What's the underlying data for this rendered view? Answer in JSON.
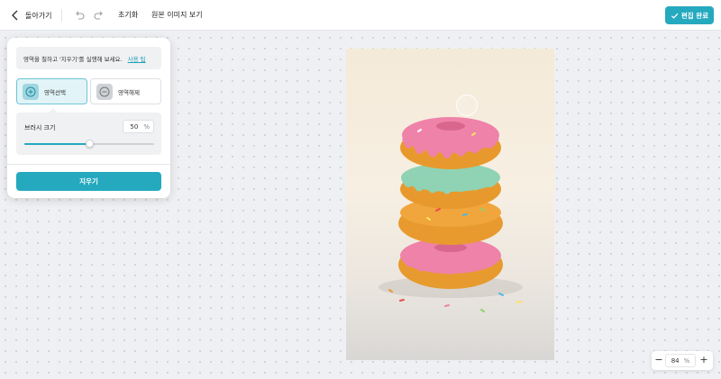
{
  "toolbar": {
    "back_label": "돌아가기",
    "reset_label": "초기화",
    "view_original_label": "원본 이미지 보기",
    "done_label": "편집 완료"
  },
  "panel": {
    "tip_text": "영역을 칠하고 '지우기'를 실행해 보세요.",
    "tip_link": "사용 팁",
    "modes": [
      {
        "label": "영역선택",
        "icon": "brush-add-icon",
        "selected": true
      },
      {
        "label": "영역해제",
        "icon": "brush-remove-icon",
        "selected": false
      }
    ],
    "brush_size_label": "브러시 크기",
    "brush_size_value": "50",
    "brush_size_unit": "%",
    "brush_size_fraction": 0.5,
    "erase_label": "지우기"
  },
  "zoom": {
    "minus": "−",
    "value": "84",
    "unit": "%",
    "plus": "+"
  },
  "colors": {
    "accent": "#25a9bf",
    "selected_bg": "#e2f4f7",
    "canvas_bg": "#eef0f3"
  }
}
